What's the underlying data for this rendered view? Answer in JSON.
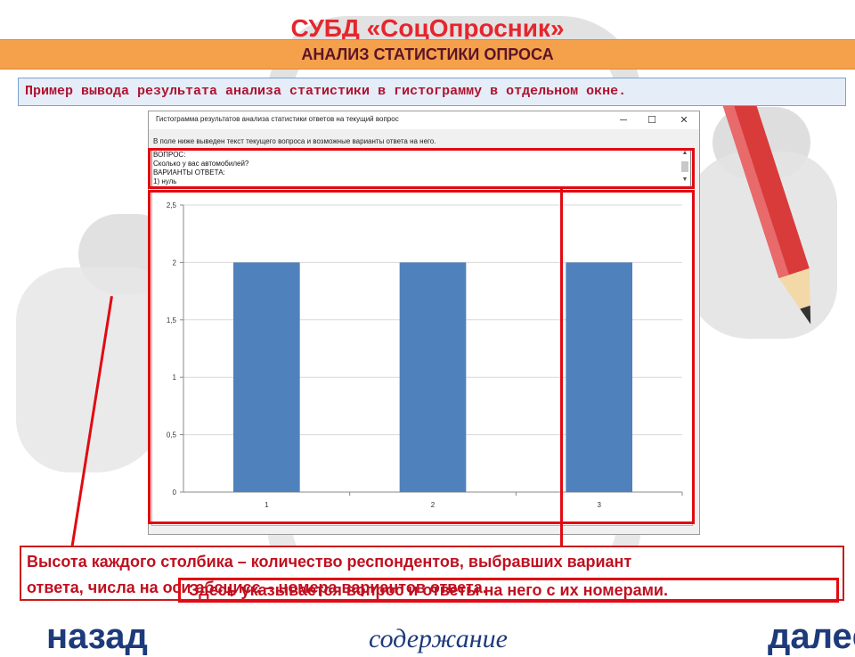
{
  "slide": {
    "title": "СУБД «СоцОпросник»",
    "subtitle": "АНАЛИЗ СТАТИСТИКИ ОПРОСА",
    "note": "Пример вывода результата анализа статистики в гистограмму в отдельном окне.",
    "colors": {
      "title": "#e5262e",
      "subtitle_bar": "#f5a04a",
      "accent_red": "#e10a12",
      "bar": "#4f81bd",
      "nav": "#1d3a7a"
    }
  },
  "window": {
    "title": "Гистограмма результатов анализа статистики ответов на текущий вопрос",
    "controls": {
      "minimize": "─",
      "maximize": "☐",
      "close": "✕"
    },
    "instruction": "В поле ниже выведен текст текущего вопроса и возможные варианты ответа на него.",
    "question_lines": [
      "ВОПРОС:",
      "Сколько у вас автомобилей?",
      "ВАРИАНТЫ ОТВЕТА:",
      "1) нуль"
    ],
    "scroll": {
      "up": "▲",
      "down": "▼"
    }
  },
  "chart_data": {
    "type": "bar",
    "categories": [
      "1",
      "2",
      "3"
    ],
    "values": [
      2,
      2,
      2
    ],
    "ylim": [
      0,
      2.5
    ],
    "yticks": [
      "0",
      "0,5",
      "1",
      "1,5",
      "2",
      "2,5"
    ],
    "grid": true
  },
  "captions": {
    "line1": "Высота каждого столбика – количество респондентов, выбравших вариант",
    "line2": "ответа, числа на оси абсцисс – номера вариантов ответа.",
    "overlay": "Здесь указывается вопрос и ответы на него с их номерами."
  },
  "nav": {
    "back": "назад",
    "contents": "содержание",
    "next": "далее"
  }
}
